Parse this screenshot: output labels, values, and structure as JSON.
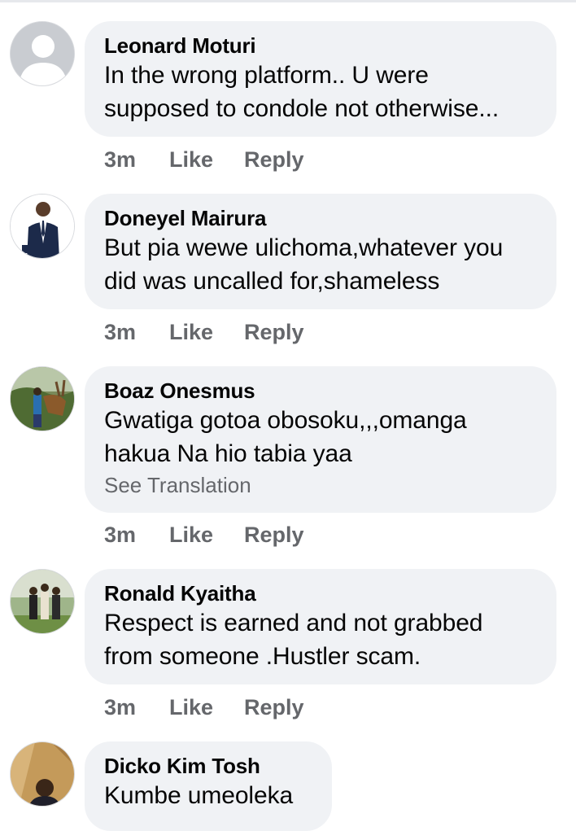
{
  "comments": [
    {
      "name": "Leonard Moturi",
      "line1": "In the wrong platform.. U were",
      "line2": "supposed to condole not otherwise...",
      "time": "3m",
      "like": "Like",
      "reply": "Reply",
      "avatar": "default-avatar-icon"
    },
    {
      "name": "Doneyel Mairura",
      "line1": "But pia wewe ulichoma,whatever you",
      "line2": "did was uncalled for,shameless",
      "time": "3m",
      "like": "Like",
      "reply": "Reply",
      "avatar": "profile-photo"
    },
    {
      "name": "Boaz Onesmus",
      "line1": "Gwatiga gotoa obosoku,,,omanga",
      "line2": "hakua  Na hio tabia yaa",
      "translation": "See Translation",
      "time": "3m",
      "like": "Like",
      "reply": "Reply",
      "avatar": "profile-photo"
    },
    {
      "name": "Ronald Kyaitha",
      "line1": "Respect is earned and not grabbed",
      "line2": "from someone .Hustler scam.",
      "time": "3m",
      "like": "Like",
      "reply": "Reply",
      "avatar": "profile-photo"
    },
    {
      "name": "Dicko Kim Tosh",
      "line1": "Kumbe umeoleka",
      "avatar": "profile-photo"
    }
  ],
  "colors": {
    "bubble": "#f0f2f5",
    "text": "#050505",
    "secondary": "#65676b"
  }
}
